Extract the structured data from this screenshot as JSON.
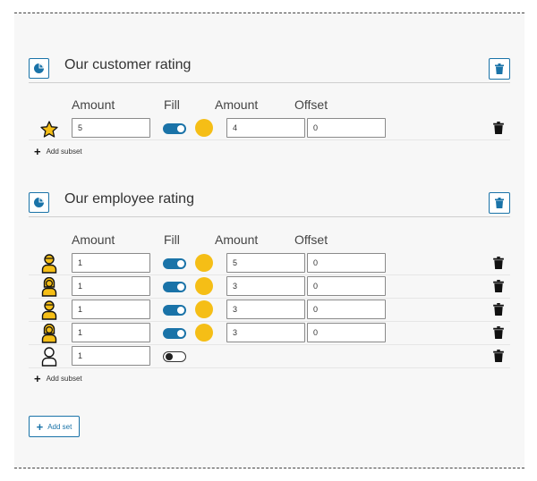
{
  "sets": [
    {
      "title": "Our customer rating",
      "columns": {
        "amount": "Amount",
        "fill": "Fill",
        "amount2": "Amount",
        "offset": "Offset"
      },
      "rows": [
        {
          "symbol": "star-icon",
          "amount": "5",
          "fill": true,
          "fill_color": "#F5BE16",
          "amount2": "4",
          "offset": "0"
        }
      ],
      "add_subset_label": "Add subset"
    },
    {
      "title": "Our employee rating",
      "columns": {
        "amount": "Amount",
        "fill": "Fill",
        "amount2": "Amount",
        "offset": "Offset"
      },
      "rows": [
        {
          "symbol": "person-icon",
          "amount": "1",
          "fill": true,
          "fill_color": "#F5BE16",
          "amount2": "5",
          "offset": "0"
        },
        {
          "symbol": "person-female-icon",
          "amount": "1",
          "fill": true,
          "fill_color": "#F5BE16",
          "amount2": "3",
          "offset": "0"
        },
        {
          "symbol": "person-icon",
          "amount": "1",
          "fill": true,
          "fill_color": "#F5BE16",
          "amount2": "3",
          "offset": "0"
        },
        {
          "symbol": "person-female-icon",
          "amount": "1",
          "fill": true,
          "fill_color": "#F5BE16",
          "amount2": "3",
          "offset": "0"
        },
        {
          "symbol": "person-outline-icon",
          "amount": "1",
          "fill": false
        }
      ],
      "add_subset_label": "Add subset"
    }
  ],
  "add_set_label": "Add set",
  "colors": {
    "accent": "#1A73A8",
    "fill": "#F5BE16",
    "panel": "#F7F7F7"
  }
}
